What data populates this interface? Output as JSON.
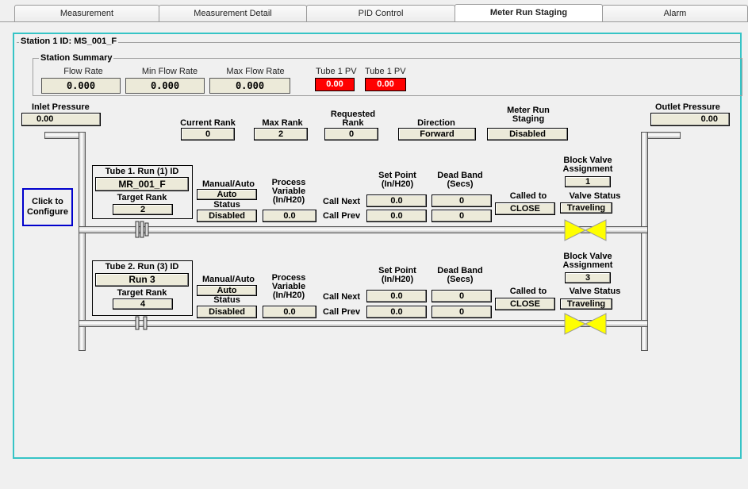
{
  "tabs": [
    "Measurement",
    "Measurement Detail",
    "PID Control",
    "Meter Run Staging",
    "Alarm"
  ],
  "active_tab": "Meter Run Staging",
  "station": {
    "id_label": "Station 1 ID: MS_001_F",
    "summary_title": "Station Summary",
    "flow_rate_label": "Flow Rate",
    "flow_rate": "0.000",
    "min_flow_label": "Min Flow Rate",
    "min_flow": "0.000",
    "max_flow_label": "Max Flow Rate",
    "max_flow": "0.000",
    "tube1_pv_label_a": "Tube 1 PV",
    "tube1_pv_a": "0.00",
    "tube1_pv_label_b": "Tube 1 PV",
    "tube1_pv_b": "0.00"
  },
  "inlet": {
    "label": "Inlet Pressure",
    "value": "0.00"
  },
  "outlet": {
    "label": "Outlet Pressure",
    "value": "0.00"
  },
  "staging": {
    "current_rank_label": "Current Rank",
    "current_rank": "0",
    "max_rank_label": "Max Rank",
    "max_rank": "2",
    "requested_rank_label": "Requested Rank",
    "requested_rank": "0",
    "direction_label": "Direction",
    "direction": "Forward",
    "meter_run_staging_label": "Meter Run Staging",
    "meter_run_staging": "Disabled"
  },
  "configure_button": "Click to Configure",
  "labels": {
    "target_rank": "Target Rank",
    "manual_auto": "Manual/Auto",
    "status": "Status",
    "process_variable": "Process Variable (In/H20)",
    "set_point": "Set Point (In/H20)",
    "dead_band": "Dead Band (Secs)",
    "call_next": "Call Next",
    "call_prev": "Call Prev",
    "called_to": "Called to",
    "block_valve": "Block Valve Assignment",
    "valve_status": "Valve Status"
  },
  "tubes": [
    {
      "title": "Tube 1. Run (1) ID",
      "run_id": "MR_001_F",
      "target_rank": "2",
      "manual_auto": "Auto",
      "status": "Disabled",
      "process_variable": "0.0",
      "set_point_next": "0.0",
      "set_point_prev": "0.0",
      "dead_band_next": "0",
      "dead_band_prev": "0",
      "called_to": "CLOSE",
      "block_valve": "1",
      "valve_status": "Traveling"
    },
    {
      "title": "Tube 2. Run (3) ID",
      "run_id": "Run 3",
      "target_rank": "4",
      "manual_auto": "Auto",
      "status": "Disabled",
      "process_variable": "0.0",
      "set_point_next": "0.0",
      "set_point_prev": "0.0",
      "dead_band_next": "0",
      "dead_band_prev": "0",
      "called_to": "CLOSE",
      "block_valve": "3",
      "valve_status": "Traveling"
    }
  ],
  "colors": {
    "panel_border": "#36c4c6",
    "alarm_red": "#ff0000",
    "valve_yellow": "#ffff00",
    "config_border": "#0000cc"
  }
}
